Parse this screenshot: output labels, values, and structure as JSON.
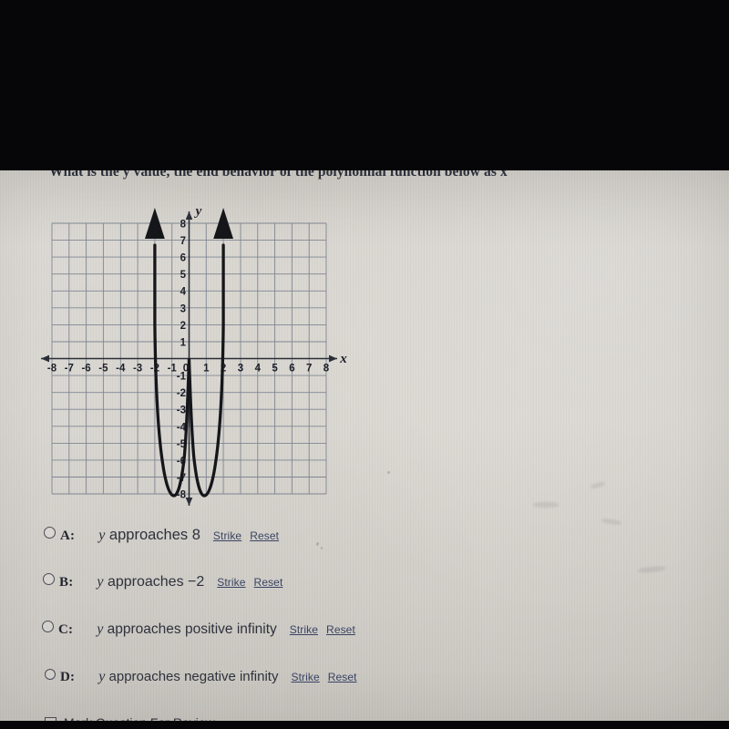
{
  "question": {
    "heading": "What is the y value, the end behavior of the polynomial function below as x"
  },
  "graph": {
    "x_axis_label": "x",
    "y_axis_label": "y",
    "x_ticks": [
      "-8",
      "-7",
      "-6",
      "-5",
      "-4",
      "-3",
      "-2",
      "-1",
      "0",
      "1",
      "2",
      "3",
      "4",
      "5",
      "6",
      "7",
      "8"
    ],
    "y_ticks": [
      "8",
      "7",
      "6",
      "5",
      "4",
      "3",
      "2",
      "1",
      "-1",
      "-2",
      "-3",
      "-4",
      "-5",
      "-6",
      "-7",
      "-8"
    ],
    "curve_color": "#15161a",
    "grid_color": "#6e7686"
  },
  "chart_data": {
    "type": "line",
    "title": "",
    "xlabel": "x",
    "ylabel": "y",
    "xlim": [
      -8,
      8
    ],
    "ylim": [
      -8,
      8
    ],
    "grid": true,
    "legend": "none",
    "xticks": [
      -8,
      -7,
      -6,
      -5,
      -4,
      -3,
      -2,
      -1,
      0,
      1,
      2,
      3,
      4,
      5,
      6,
      7,
      8
    ],
    "yticks": [
      -8,
      -7,
      -6,
      -5,
      -4,
      -3,
      -2,
      -1,
      1,
      2,
      3,
      4,
      5,
      6,
      7,
      8
    ],
    "annotations": [
      "arrowhead pointing up at x = -2, above y = 8",
      "arrowhead pointing up at x = 2, above y = 8"
    ],
    "series": [
      {
        "name": "polynomial",
        "description": "W-shaped quartic: local maximum at (0, 0), minima near (-1.5, -8) and (1.5, -8), branches rise steeply to positive infinity at x = -2 and x = 2",
        "x": [
          -2.05,
          -2.0,
          -1.95,
          -1.9,
          -1.85,
          -1.8,
          -1.7,
          -1.6,
          -1.5,
          -1.4,
          -1.3,
          -1.2,
          -1.1,
          -1.0,
          -0.85,
          -0.7,
          -0.5,
          -0.3,
          -0.15,
          0,
          0.15,
          0.3,
          0.5,
          0.7,
          0.85,
          1.0,
          1.1,
          1.2,
          1.3,
          1.4,
          1.5,
          1.6,
          1.7,
          1.8,
          1.85,
          1.9,
          1.95,
          2.0,
          2.05
        ],
        "y": [
          9.5,
          6.0,
          2.0,
          0.0,
          -2.5,
          -4.6,
          -6.8,
          -7.8,
          -8.0,
          -7.8,
          -7.2,
          -6.3,
          -5.2,
          -4.1,
          -2.6,
          -1.4,
          -0.5,
          -0.1,
          -0.02,
          0.0,
          -0.02,
          -0.1,
          -0.5,
          -1.4,
          -2.6,
          -4.1,
          -5.2,
          -6.3,
          -7.2,
          -7.8,
          -8.0,
          -7.8,
          -6.8,
          -4.6,
          -2.5,
          0.0,
          2.0,
          6.0,
          9.5
        ]
      }
    ]
  },
  "options": [
    {
      "letter": "A:",
      "text_before": "y",
      "text_after": " approaches 8",
      "strike_label": "Strike",
      "reset_label": "Reset",
      "selected": false
    },
    {
      "letter": "B:",
      "text_before": "y",
      "text_after": " approaches −2",
      "strike_label": "Strike",
      "reset_label": "Reset",
      "selected": false
    },
    {
      "letter": "C:",
      "text_before": "y",
      "text_after": " approaches positive infinity",
      "strike_label": "Strike",
      "reset_label": "Reset",
      "selected": false
    },
    {
      "letter": "D:",
      "text_before": "y",
      "text_after": " approaches negative infinity",
      "strike_label": "Strike",
      "reset_label": "Reset",
      "selected": false
    }
  ],
  "mark_for_review": {
    "label": "Mark Question For Review",
    "checked": false
  }
}
